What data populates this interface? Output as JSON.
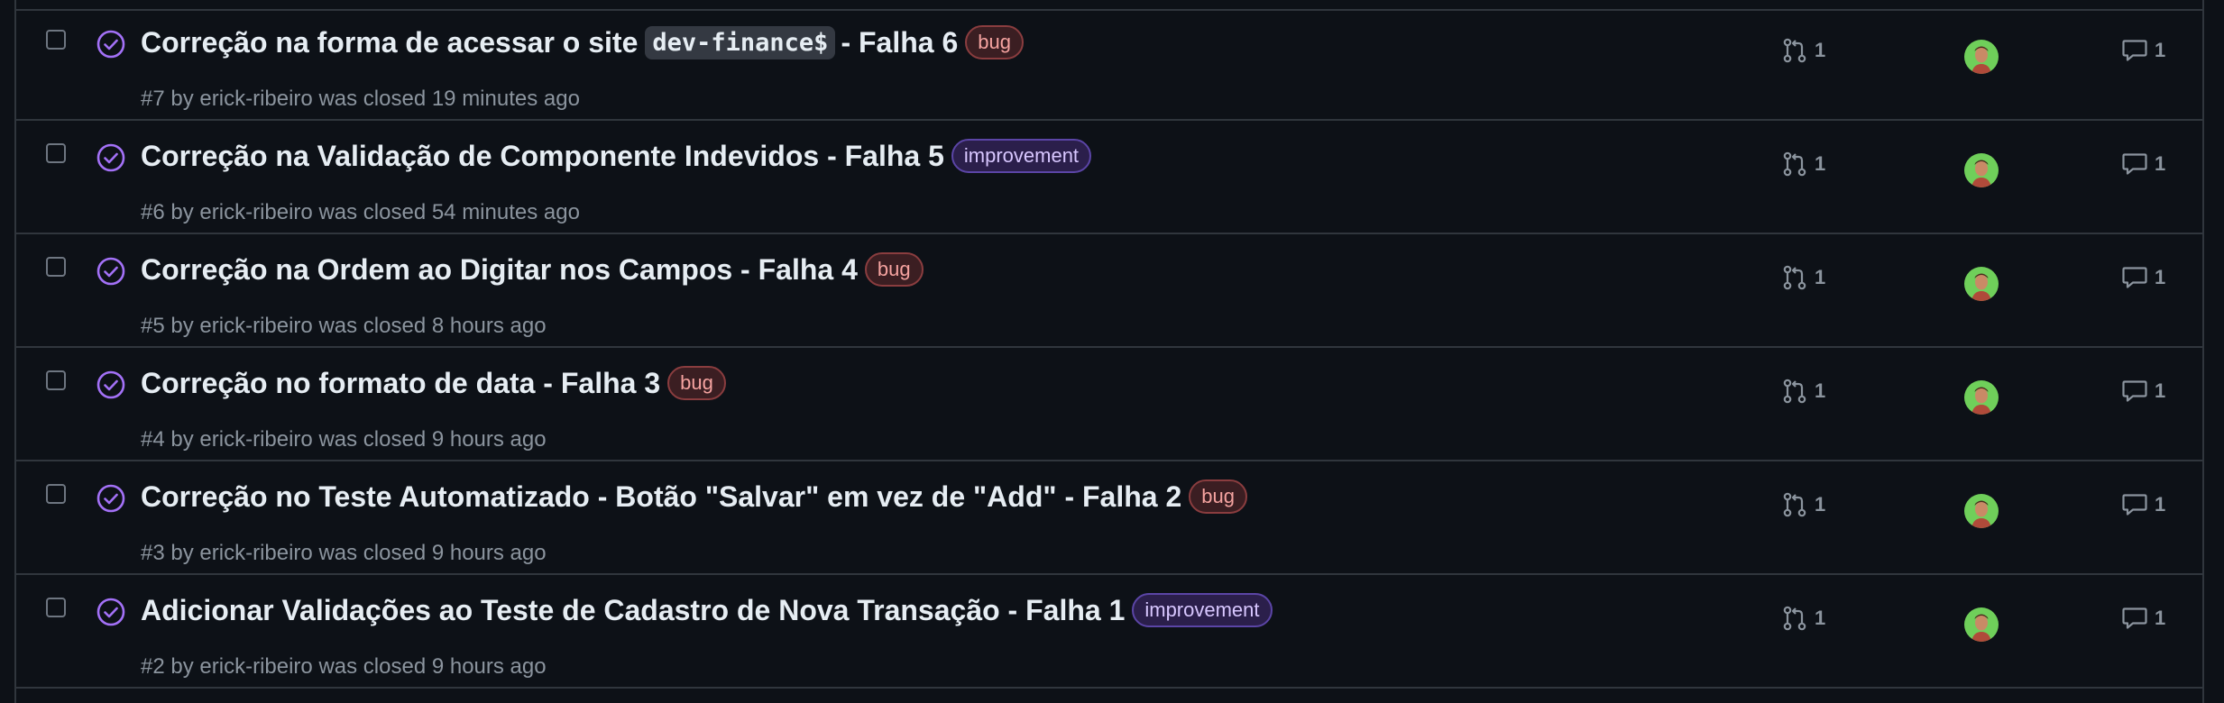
{
  "colors": {
    "background": "#0d1117",
    "border": "#30363d",
    "closed_icon": "#a371f7",
    "muted_text": "#8b949e",
    "bug_label": "#f5a3a0",
    "improvement_label": "#d8c7ff"
  },
  "issues": [
    {
      "title_before": "Correção na forma de acessar o site",
      "title_code": "dev-finance$",
      "title_after": "- Falha 6",
      "label": "bug",
      "label_type": "bug",
      "number": "#7",
      "by": "by",
      "author": "erick-ribeiro",
      "closed_text": "was closed 19 minutes ago",
      "linked_prs": "1",
      "comments": "1",
      "state_icon": "closed-issue-icon"
    },
    {
      "title_before": "Correção na Validação de Componente Indevidos - Falha 5",
      "title_code": "",
      "title_after": "",
      "label": "improvement",
      "label_type": "improvement",
      "number": "#6",
      "by": "by",
      "author": "erick-ribeiro",
      "closed_text": "was closed 54 minutes ago",
      "linked_prs": "1",
      "comments": "1",
      "state_icon": "closed-issue-icon"
    },
    {
      "title_before": "Correção na Ordem ao Digitar nos Campos - Falha 4",
      "title_code": "",
      "title_after": "",
      "label": "bug",
      "label_type": "bug",
      "number": "#5",
      "by": "by",
      "author": "erick-ribeiro",
      "closed_text": "was closed 8 hours ago",
      "linked_prs": "1",
      "comments": "1",
      "state_icon": "closed-issue-icon"
    },
    {
      "title_before": "Correção no formato de data - Falha 3",
      "title_code": "",
      "title_after": "",
      "label": "bug",
      "label_type": "bug",
      "number": "#4",
      "by": "by",
      "author": "erick-ribeiro",
      "closed_text": "was closed 9 hours ago",
      "linked_prs": "1",
      "comments": "1",
      "state_icon": "closed-issue-icon"
    },
    {
      "title_before": "Correção no Teste Automatizado - Botão \"Salvar\" em vez de \"Add\" - Falha 2",
      "title_code": "",
      "title_after": "",
      "label": "bug",
      "label_type": "bug",
      "number": "#3",
      "by": "by",
      "author": "erick-ribeiro",
      "closed_text": "was closed 9 hours ago",
      "linked_prs": "1",
      "comments": "1",
      "state_icon": "closed-issue-icon"
    },
    {
      "title_before": "Adicionar Validações ao Teste de Cadastro de Nova Transação - Falha 1",
      "title_code": "",
      "title_after": "",
      "label": "improvement",
      "label_type": "improvement",
      "number": "#2",
      "by": "by",
      "author": "erick-ribeiro",
      "closed_text": "was closed 9 hours ago",
      "linked_prs": "1",
      "comments": "1",
      "state_icon": "closed-issue-icon"
    }
  ]
}
